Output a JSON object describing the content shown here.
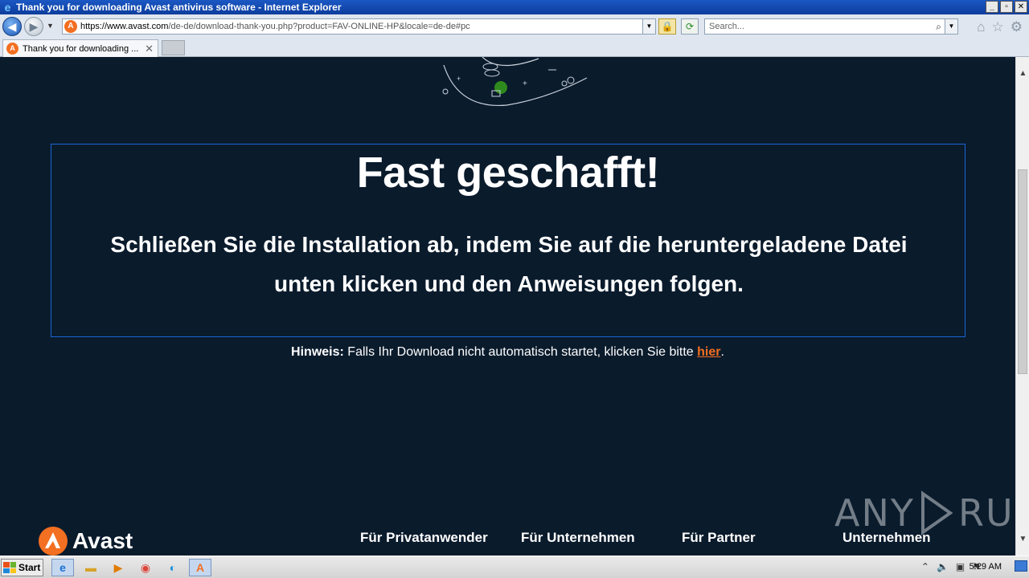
{
  "window": {
    "title": "Thank you for downloading Avast antivirus software - Internet Explorer",
    "buttons": {
      "minimize": "_",
      "restore": "▫",
      "close": "✕"
    }
  },
  "address_bar": {
    "url_host": "https://www.avast.com",
    "url_rest": "/de-de/download-thank-you.php?product=FAV-ONLINE-HP&locale=de-de#pc",
    "search_placeholder": "Search..."
  },
  "tabs": [
    {
      "label": "Thank you for downloading ...",
      "active": true
    }
  ],
  "page": {
    "headline": "Fast geschafft!",
    "subtext": "Schließen Sie die Installation ab, indem Sie auf die heruntergeladene Datei unten klicken und den Anweisungen folgen.",
    "hint_label": "Hinweis:",
    "hint_text": " Falls Ihr Download nicht automatisch startet, klicken Sie bitte ",
    "hint_link": "hier",
    "hint_end": ".",
    "logo_text": "Avast",
    "footer_links": [
      "Für Privatanwender",
      "Für Unternehmen",
      "Für Partner",
      "Unternehmen"
    ],
    "watermark": {
      "left": "ANY",
      "right": "RUN"
    }
  },
  "taskbar": {
    "start_label": "Start",
    "clock": "5:29 AM"
  },
  "colors": {
    "page_bg": "#0a1b2c",
    "accent_orange": "#f36f21",
    "box_border": "#1a65d6"
  }
}
